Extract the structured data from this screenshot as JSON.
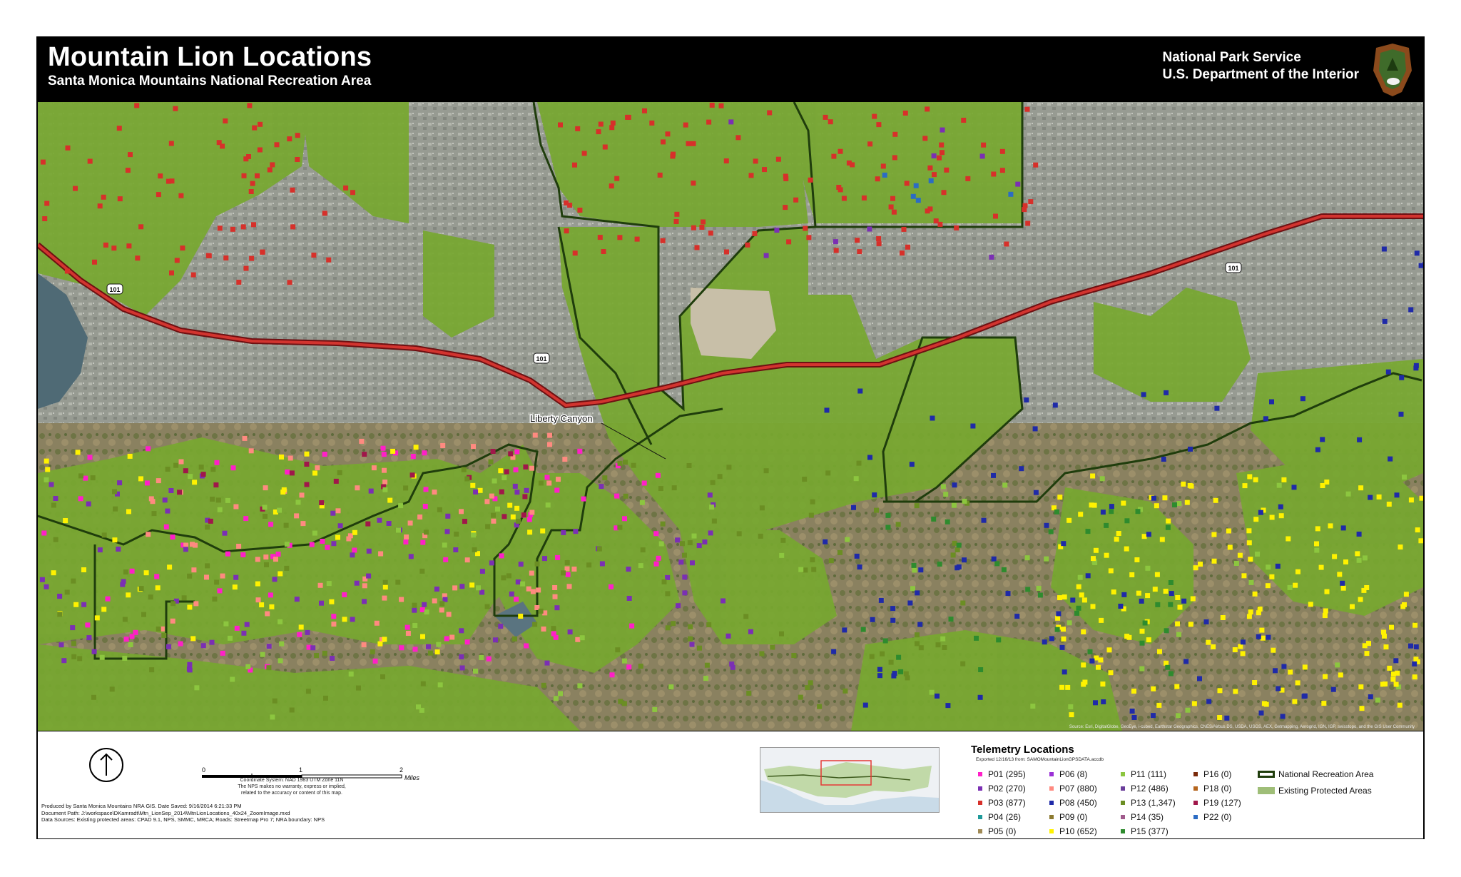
{
  "header": {
    "title": "Mountain Lion Locations",
    "subtitle": "Santa Monica Mountains National Recreation Area",
    "agency_line1": "National Park Service",
    "agency_line2": "U.S. Department of the Interior"
  },
  "map": {
    "label_liberty_canyon": "Liberty Canyon",
    "highway_shield": "101",
    "credits": "Source: Esri, DigitalGlobe, GeoEye, i-cubed, Earthstar Geographics, CNES/Airbus DS, USDA, USGS, AEX, Getmapping, Aerogrid, IGN, IGP, swisstopo, and the GIS User Community"
  },
  "footer": {
    "scale_0": "0",
    "scale_1": "1",
    "scale_2": "2",
    "scale_unit": "Miles",
    "coord_line1": "Coordinate System: NAD 1983 UTM Zone 11N",
    "coord_line2": "The NPS makes no warranty, express or implied,",
    "coord_line3": "related to the accuracy or content of this map.",
    "produced_line1": "Produced by Santa Monica Mountains NRA GIS. Date Saved: 9/16/2014 6:21:33 PM",
    "produced_line2": "Document Path: J:\\workspace\\DKamradt\\Mtn_LionSep_2014\\MtnLionLocations_40x24_ZoomImage.mxd",
    "produced_line3": "Data Sources:  Existing protected areas: CPAD 9.1, NPS, SMMC, MRCA; Roads: Streetmap Pro 7; NRA boundary: NPS"
  },
  "legend": {
    "title": "Telemetry Locations",
    "exported": "Exported 12/16/13 from: SAMOMountainLionGPSDATA.accdb",
    "columns": [
      [
        {
          "label": "P01  (295)",
          "color": "#ff1fc8"
        },
        {
          "label": "P02  (270)",
          "color": "#7b2fb4"
        },
        {
          "label": "P03  (877)",
          "color": "#d7302a"
        },
        {
          "label": "P04  (26)",
          "color": "#1f9a9a"
        },
        {
          "label": "P05  (0)",
          "color": "#a08a55"
        }
      ],
      [
        {
          "label": "P06  (8)",
          "color": "#9b30d6"
        },
        {
          "label": "P07  (880)",
          "color": "#ff8a80"
        },
        {
          "label": "P08  (450)",
          "color": "#1f2aa8"
        },
        {
          "label": "P09  (0)",
          "color": "#8c7a30"
        },
        {
          "label": "P10  (652)",
          "color": "#fff200"
        }
      ],
      [
        {
          "label": "P11  (111)",
          "color": "#8cc63f"
        },
        {
          "label": "P12  (486)",
          "color": "#6a3d9a"
        },
        {
          "label": "P13  (1,347)",
          "color": "#6b8e23"
        },
        {
          "label": "P14  (35)",
          "color": "#a05a8c"
        },
        {
          "label": "P15  (377)",
          "color": "#2e8b2e"
        }
      ],
      [
        {
          "label": "P16  (0)",
          "color": "#7a2a0a"
        },
        {
          "label": "P18  (0)",
          "color": "#b5651d"
        },
        {
          "label": "P19  (127)",
          "color": "#a0174a"
        },
        {
          "label": "P22  (0)",
          "color": "#2b6cc4"
        }
      ]
    ],
    "areas": [
      {
        "label": "National Recreation Area",
        "type": "outline",
        "color": "#1f3d0c"
      },
      {
        "label": "Existing Protected Areas",
        "type": "fill",
        "color": "#9fbe78"
      }
    ]
  },
  "colors": {
    "protected_green": "#77a830",
    "urban_gray": "#959a8e",
    "highway_red": "#c2282c",
    "boundary_dark": "#1f3d0c"
  }
}
